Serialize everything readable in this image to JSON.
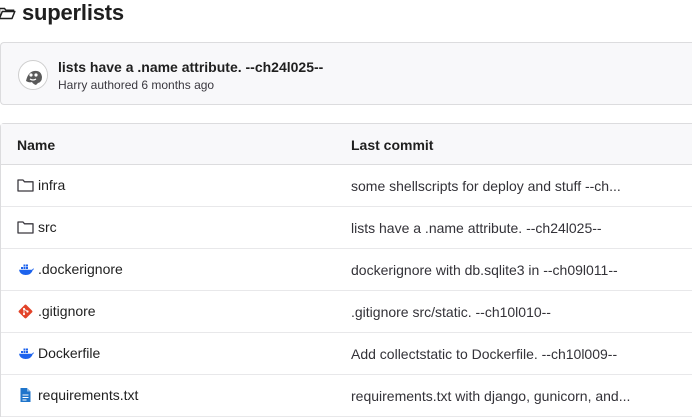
{
  "header": {
    "title": "superlists"
  },
  "commit": {
    "title": "lists have a .name attribute. --ch24l025--",
    "meta": "Harry authored 6 months ago"
  },
  "table": {
    "columns": [
      "Name",
      "Last commit"
    ],
    "rows": [
      {
        "icon": "folder-icon",
        "name": "infra",
        "commit": "some shellscripts for deploy and stuff --ch..."
      },
      {
        "icon": "folder-icon",
        "name": "src",
        "commit": "lists have a .name attribute. --ch24l025--"
      },
      {
        "icon": "docker-icon",
        "name": ".dockerignore",
        "commit": "dockerignore with db.sqlite3 in --ch09l011--"
      },
      {
        "icon": "git-icon",
        "name": ".gitignore",
        "commit": ".gitignore src/static. --ch10l010--"
      },
      {
        "icon": "docker-icon",
        "name": "Dockerfile",
        "commit": "Add collectstatic to Dockerfile. --ch10l009--"
      },
      {
        "icon": "text-file-icon",
        "name": "requirements.txt",
        "commit": "requirements.txt with django, gunicorn, and..."
      }
    ]
  },
  "colors": {
    "docker": "#1d63ed",
    "git": "#e24329",
    "text_file": "#1f75cb"
  }
}
